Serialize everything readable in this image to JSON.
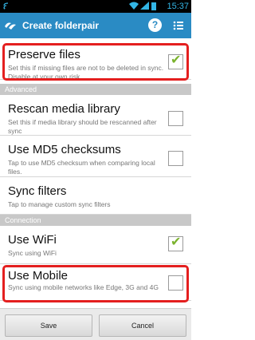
{
  "status_bar": {
    "time": "15:37",
    "icons": [
      "cast-icon",
      "wifi-icon",
      "signal-icon",
      "battery-icon"
    ]
  },
  "action_bar": {
    "title": "Create folderpair",
    "icons": [
      "app-logo-icon",
      "help-icon",
      "menu-icon"
    ],
    "accent_color": "#2a8bc4"
  },
  "settings": {
    "preserve_files": {
      "title": "Preserve files",
      "subtitle": "Set this if missing files are not to be deleted in sync. Disable at your own risk.",
      "checked": true
    },
    "advanced_header": "Advanced",
    "rescan_media": {
      "title": "Rescan media library",
      "subtitle": "Set this if media library should be rescanned after sync",
      "checked": false
    },
    "md5_checksums": {
      "title": "Use MD5 checksums",
      "subtitle": "Tap to use MD5 checksum when comparing local files.",
      "checked": false
    },
    "sync_filters": {
      "title": "Sync filters",
      "subtitle": "Tap to manage custom sync filters"
    },
    "connection_header": "Connection",
    "use_wifi": {
      "title": "Use WiFi",
      "subtitle": "Sync using WiFi",
      "checked": true
    },
    "use_mobile": {
      "title": "Use Mobile",
      "subtitle": "Sync using mobile networks like Edge, 3G and 4G",
      "checked": false
    }
  },
  "footer": {
    "save_label": "Save",
    "cancel_label": "Cancel"
  },
  "colors": {
    "highlight": "#e41f1f",
    "check": "#7bb32e"
  }
}
